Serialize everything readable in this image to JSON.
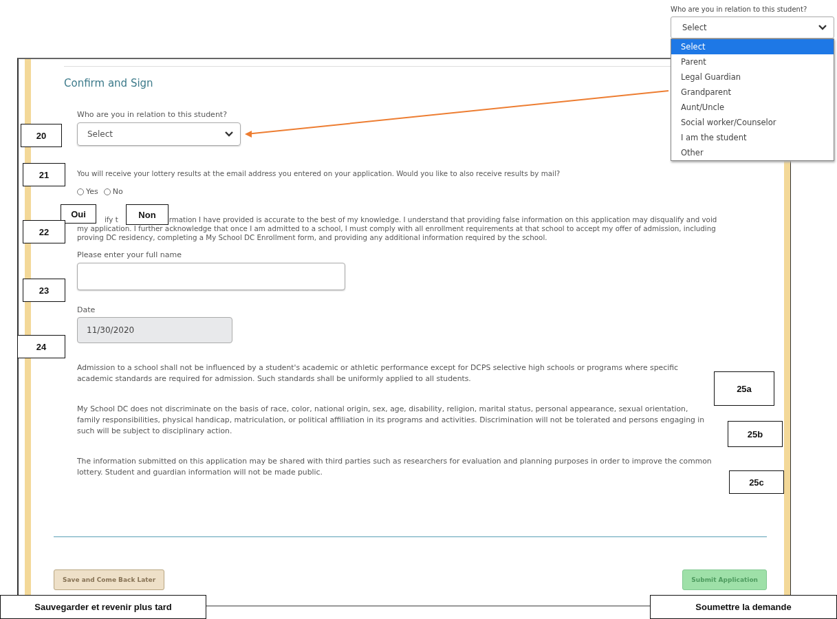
{
  "form": {
    "heading": "Confirm and Sign",
    "relation": {
      "label": "Who are you in relation to this student?",
      "value": "Select"
    },
    "mail_question": {
      "text": "You will receive your lottery results at the email address you entered on your application. Would you like to also receive results by mail?",
      "options": [
        {
          "label": "Yes",
          "selected": false
        },
        {
          "label": "No",
          "selected": false
        }
      ]
    },
    "certification": {
      "fragment": "ify t",
      "text": "rmation I have provided is accurate to the best of my knowledge. I understand that providing false information on this application may disqualify and void my application. I further acknowledge that once I am admitted to a school, I must comply with all enrollment requirements at that school to accept my offer of admission, including proving DC residency, completing a My School DC Enrollment form, and providing any additional information required by the school."
    },
    "full_name": {
      "label": "Please enter your full name"
    },
    "date": {
      "label": "Date",
      "value": "11/30/2020",
      "disabled": true
    },
    "notices": [
      "Admission to a school shall not be influenced by a student's academic or athletic performance except for DCPS selective high schools or programs where specific academic standards are required for admission. Such standards shall be uniformly applied to all students.",
      "My School DC does not discriminate on the basis of race, color, national origin, sex, age, disability, religion, marital status, personal appearance, sexual orientation, family responsibilities, physical handicap, matriculation, or political affiliation in its programs and activities. Discrimination will not be tolerated and persons engaging in such will be subject to disciplinary action.",
      "The information submitted on this application may be shared with third parties such as researchers for evaluation and planning purposes in order to improve the common lottery. Student and guardian information will not be made public."
    ],
    "buttons": [
      {
        "label": "Save and Come Back Later",
        "kind": "save"
      },
      {
        "label": "Submit Application",
        "kind": "submit"
      }
    ]
  },
  "dropdown_popup": {
    "label": "Who are you in relation to this student?",
    "value": "Select",
    "options": [
      {
        "label": "Select",
        "selected": true
      },
      {
        "label": "Parent",
        "selected": false
      },
      {
        "label": "Legal Guardian",
        "selected": false
      },
      {
        "label": "Grandparent",
        "selected": false
      },
      {
        "label": "Aunt/Uncle",
        "selected": false
      },
      {
        "label": "Social worker/Counselor",
        "selected": false
      },
      {
        "label": "I am the student",
        "selected": false
      },
      {
        "label": "Other",
        "selected": false
      }
    ]
  },
  "annotations": [
    {
      "label": "20"
    },
    {
      "label": "21"
    },
    {
      "label": "Oui"
    },
    {
      "label": "Non"
    },
    {
      "label": "22"
    },
    {
      "label": "23"
    },
    {
      "label": "24"
    },
    {
      "label": "25a"
    },
    {
      "label": "25b"
    },
    {
      "label": "25c"
    },
    {
      "label": "Sauvegarder et revenir plus tard"
    },
    {
      "label": "Soumettre la demande"
    }
  ]
}
